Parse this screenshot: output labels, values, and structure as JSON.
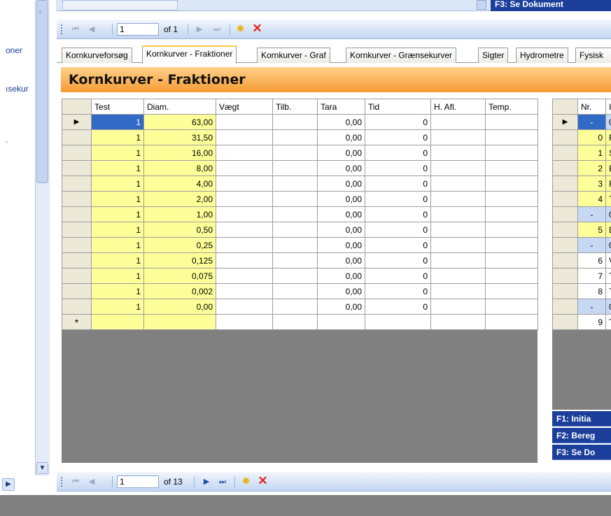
{
  "sidebar": {
    "items": [
      "oner",
      "ısekur",
      "."
    ]
  },
  "top": {
    "f3_label": "F3: Se Dokument"
  },
  "navigator_top": {
    "position": "1",
    "of_text": "of 1"
  },
  "tabs": [
    {
      "label": "Kornkurveforsøg"
    },
    {
      "label": "Kornkurver - Fraktioner"
    },
    {
      "label": "Kornkurver - Graf"
    },
    {
      "label": "Kornkurver - Grænsekurver"
    },
    {
      "label": "Sigter"
    },
    {
      "label": "Hydrometre"
    },
    {
      "label": "Fysisk"
    }
  ],
  "main": {
    "title": "Kornkurver - Fraktioner"
  },
  "grid": {
    "columns": [
      "Test",
      "Diam.",
      "Vægt",
      "Tilb.",
      "Tara",
      "Tid",
      "H. Afl.",
      "Temp."
    ],
    "rows": [
      [
        "1",
        "63,00",
        "",
        "",
        "0,00",
        "0",
        "",
        ""
      ],
      [
        "1",
        "31,50",
        "",
        "",
        "0,00",
        "0",
        "",
        ""
      ],
      [
        "1",
        "16,00",
        "",
        "",
        "0,00",
        "0",
        "",
        ""
      ],
      [
        "1",
        "8,00",
        "",
        "",
        "0,00",
        "0",
        "",
        ""
      ],
      [
        "1",
        "4,00",
        "",
        "",
        "0,00",
        "0",
        "",
        ""
      ],
      [
        "1",
        "2,00",
        "",
        "",
        "0,00",
        "0",
        "",
        ""
      ],
      [
        "1",
        "1,00",
        "",
        "",
        "0,00",
        "0",
        "",
        ""
      ],
      [
        "1",
        "0,50",
        "",
        "",
        "0,00",
        "0",
        "",
        ""
      ],
      [
        "1",
        "0,25",
        "",
        "",
        "0,00",
        "0",
        "",
        ""
      ],
      [
        "1",
        "0,125",
        "",
        "",
        "0,00",
        "0",
        "",
        ""
      ],
      [
        "1",
        "0,075",
        "",
        "",
        "0,00",
        "0",
        "",
        ""
      ],
      [
        "1",
        "0,002",
        "",
        "",
        "0,00",
        "0",
        "",
        ""
      ],
      [
        "1",
        "0,00",
        "",
        "",
        "0,00",
        "0",
        "",
        ""
      ]
    ],
    "current_row_marker": "▶",
    "new_row_marker": "*"
  },
  "right_grid": {
    "columns": [
      "Nr.",
      "I"
    ],
    "rows": [
      {
        "nr": "-",
        "txt": "0",
        "type": "group-selected"
      },
      {
        "nr": "0",
        "txt": "F",
        "type": "yellow"
      },
      {
        "nr": "1",
        "txt": "S",
        "type": "yellow"
      },
      {
        "nr": "2",
        "txt": "E",
        "type": "yellow"
      },
      {
        "nr": "3",
        "txt": "F",
        "type": "yellow"
      },
      {
        "nr": "4",
        "txt": "T",
        "type": "yellow"
      },
      {
        "nr": "-",
        "txt": "0",
        "type": "group"
      },
      {
        "nr": "5",
        "txt": "D",
        "type": "yellow"
      },
      {
        "nr": "-",
        "txt": "0",
        "type": "group"
      },
      {
        "nr": "6",
        "txt": "V",
        "type": "white"
      },
      {
        "nr": "7",
        "txt": "T",
        "type": "white"
      },
      {
        "nr": "8",
        "txt": "T",
        "type": "white"
      },
      {
        "nr": "-",
        "txt": "0",
        "type": "group"
      },
      {
        "nr": "9",
        "txt": "T",
        "type": "white"
      }
    ],
    "current_row_marker": "▶"
  },
  "function_keys": [
    "F1: Initia",
    "F2: Bereg",
    "F3: Se Do"
  ],
  "navigator_bottom": {
    "position": "1",
    "of_text": "of 13"
  },
  "colors": {
    "accent_blue": "#1c3f9b",
    "yellow_cell": "#ffff99",
    "selected": "#316ac5",
    "title_orange": "#f59c34"
  }
}
